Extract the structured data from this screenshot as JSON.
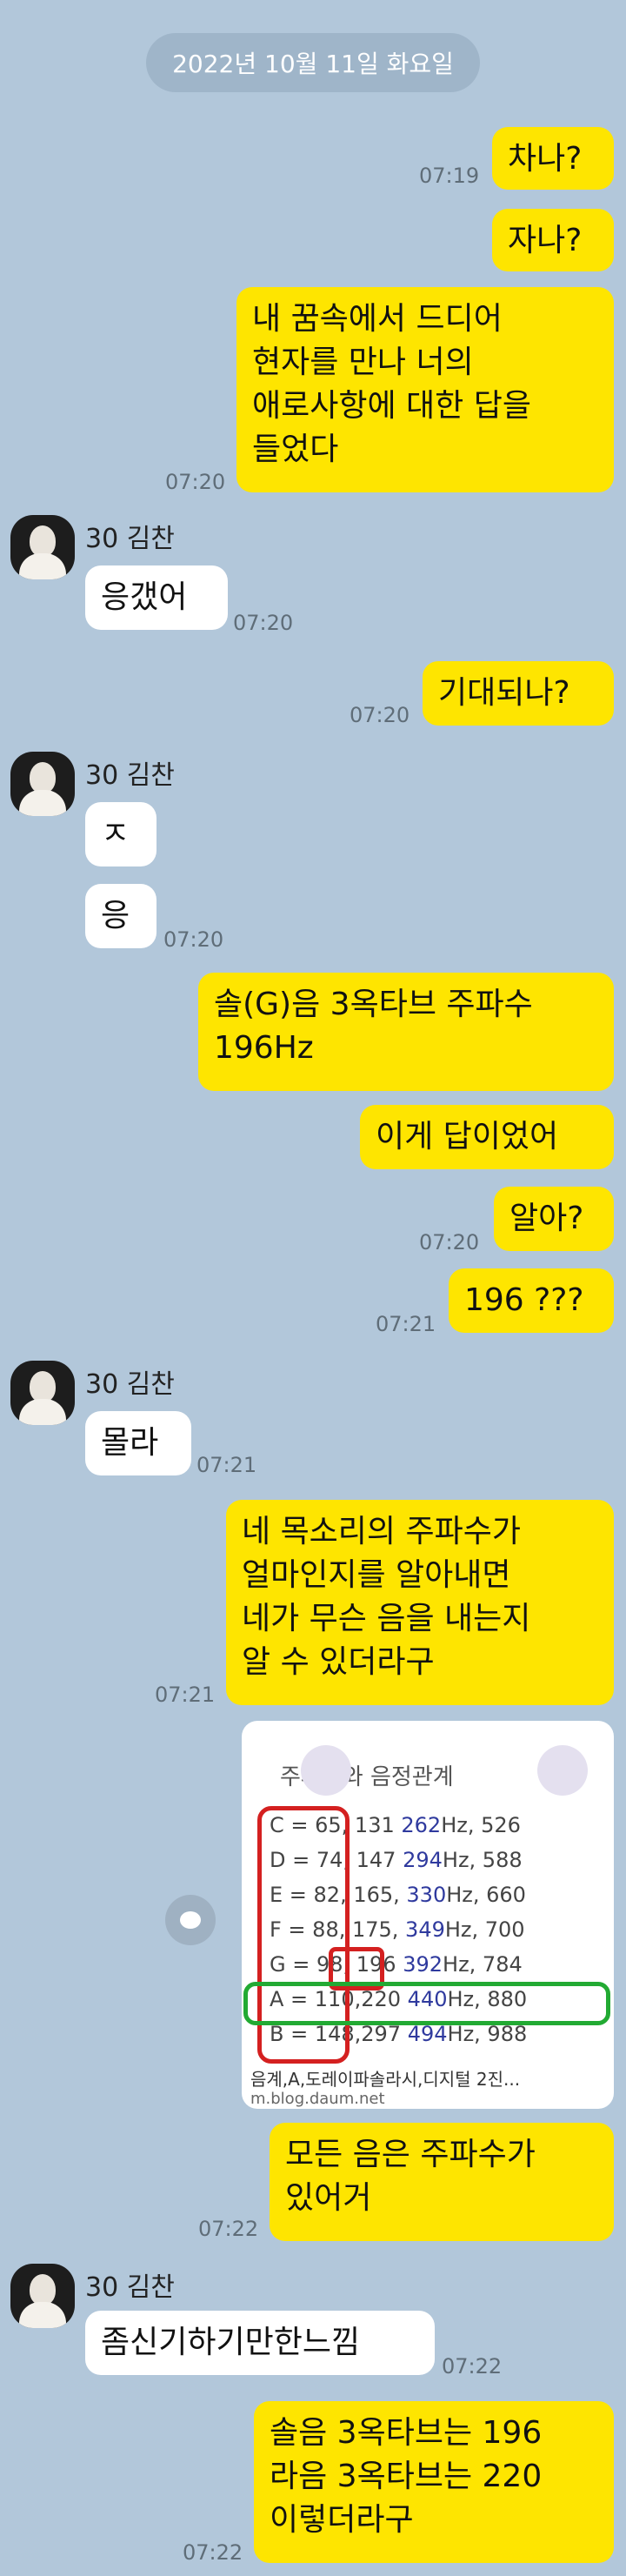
{
  "date": "2022년 10월 11일 화요일",
  "sender": "30 김찬",
  "messages": {
    "m1": "차나?",
    "m2": "자나?",
    "t2": "07:19",
    "m3": "내 꿈속에서 드디어\n현자를 만나 너의\n애로사항에 대한 답을\n들었다",
    "t3": "07:20",
    "r1": "응갰어",
    "tr1": "07:20",
    "m4": "기대되나?",
    "t4": "07:20",
    "r2": "ㅈ",
    "r3": "응",
    "tr3": "07:20",
    "m5": "솔(G)음 3옥타브 주파수\n196Hz",
    "m6": "이게 답이었어",
    "m7": "알아?",
    "t7": "07:20",
    "m8": "196 ???",
    "t8": "07:21",
    "r4": "몰라",
    "tr4": "07:21",
    "m9": "네 목소리의 주파수가\n얼마인지를 알아내면\n네가 무슨 음을 내는지\n알 수 있더라구",
    "t9": "07:21",
    "m10": "모든 음은 주파수가\n있어거",
    "t10": "07:22",
    "r5": "좀신기하기만한느낌",
    "tr5": "07:22",
    "m11": "솔음 3옥타브는 196\n라음 3옥타브는 220\n이렇더라구",
    "t11": "07:22"
  },
  "image": {
    "title": "주파수와 음정관계",
    "rows": [
      {
        "a": "C = 65, 131",
        "b": "262",
        "c": "Hz, 526"
      },
      {
        "a": "D = 74, 147",
        "b": "294",
        "c": "Hz, 588"
      },
      {
        "a": "E = 82, 165,",
        "b": "330",
        "c": "Hz, 660"
      },
      {
        "a": "F = 88, 175,",
        "b": "349",
        "c": "Hz, 700"
      },
      {
        "a": "G = 98, 196",
        "b": "392",
        "c": "Hz, 784"
      },
      {
        "a": "A = 110,220",
        "b": "440",
        "c": "Hz, 880"
      },
      {
        "a": "B = 148,297",
        "b": "494",
        "c": "Hz, 988"
      }
    ],
    "caption": "음계,A,도레이파솔라시,디지털 2진...",
    "source": "m.blog.daum.net"
  },
  "colors": {
    "background": "#b2c7da",
    "my_bubble": "#fee500",
    "other_bubble": "#ffffff",
    "highlight_red": "#d42020",
    "highlight_green": "#22aa33"
  }
}
